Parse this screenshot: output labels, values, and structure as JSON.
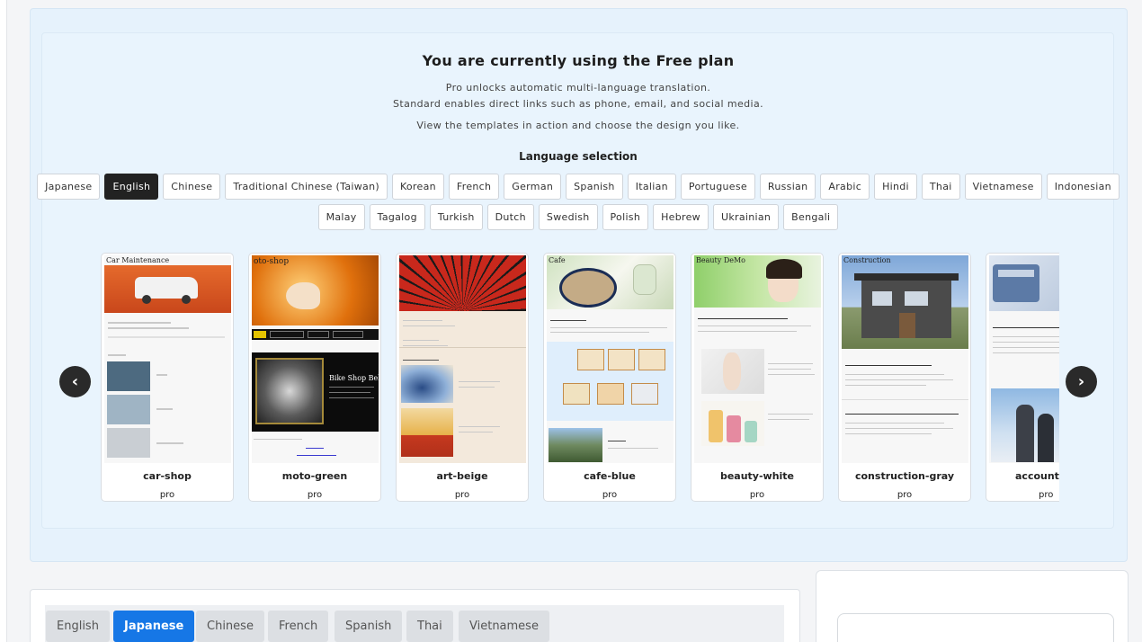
{
  "plan": {
    "title": "You are currently using the Free plan",
    "desc_line1": "Pro unlocks automatic multi-language translation.",
    "desc_line2": "Standard enables direct links such as phone, email, and social media.",
    "desc_line3": "View the templates in action and choose the design you like."
  },
  "language_selection": {
    "heading": "Language selection",
    "selected": "English",
    "row1": [
      "Japanese",
      "English",
      "Chinese",
      "Traditional Chinese (Taiwan)",
      "Korean",
      "French",
      "German",
      "Spanish",
      "Italian",
      "Portuguese",
      "Russian",
      "Arabic",
      "Hindi",
      "Thai",
      "Vietnamese",
      "Indonesian"
    ],
    "row2": [
      "Malay",
      "Tagalog",
      "Turkish",
      "Dutch",
      "Swedish",
      "Polish",
      "Hebrew",
      "Ukrainian",
      "Bengali"
    ]
  },
  "carousel": {
    "prev_icon": "chevron-left-icon",
    "next_icon": "chevron-right-icon",
    "templates": [
      {
        "name": "car-shop",
        "tier": "pro",
        "thumb_header": "Car Maintenance"
      },
      {
        "name": "moto-green",
        "tier": "pro",
        "thumb_header": "oto-shop",
        "thumb_caption": "Bike Shop Bebhe"
      },
      {
        "name": "art-beige",
        "tier": "pro"
      },
      {
        "name": "cafe-blue",
        "tier": "pro",
        "thumb_header": "Cafe"
      },
      {
        "name": "beauty-white",
        "tier": "pro",
        "thumb_header": "Beauty DeMo"
      },
      {
        "name": "construction-gray",
        "tier": "pro",
        "thumb_header": "Construction"
      },
      {
        "name": "accountan",
        "tier": "pro"
      }
    ]
  },
  "bottom_tabs": {
    "selected": "Japanese",
    "items": [
      "English",
      "Japanese",
      "Chinese",
      "French",
      "Spanish",
      "Thai",
      "Vietnamese"
    ]
  },
  "colors": {
    "panel_bg": "#e9f4fd",
    "active_language": "#222222",
    "active_tab": "#1677e6",
    "nav_arrow": "#2a2a2a"
  }
}
